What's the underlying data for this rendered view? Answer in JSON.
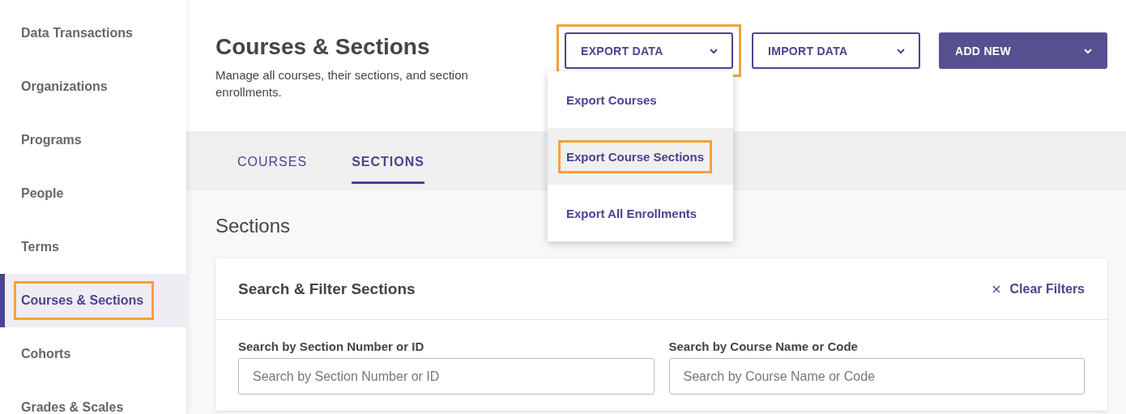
{
  "sidebar": {
    "items": [
      {
        "label": "Data Transactions",
        "selected": false,
        "highlighted": false
      },
      {
        "label": "Organizations",
        "selected": false,
        "highlighted": false
      },
      {
        "label": "Programs",
        "selected": false,
        "highlighted": false
      },
      {
        "label": "People",
        "selected": false,
        "highlighted": false
      },
      {
        "label": "Terms",
        "selected": false,
        "highlighted": false
      },
      {
        "label": "Courses & Sections",
        "selected": true,
        "highlighted": true
      },
      {
        "label": "Cohorts",
        "selected": false,
        "highlighted": false
      },
      {
        "label": "Grades & Scales",
        "selected": false,
        "highlighted": false
      }
    ]
  },
  "header": {
    "title": "Courses & Sections",
    "subtitle": "Manage all courses, their sections, and section enrollments.",
    "buttons": [
      {
        "label": "EXPORT DATA",
        "kind": "outline",
        "highlighted": true,
        "menu": [
          {
            "label": "Export Courses",
            "hovered": false,
            "highlighted": false
          },
          {
            "label": "Export Course Sections",
            "hovered": true,
            "highlighted": true
          },
          {
            "label": "Export All Enrollments",
            "hovered": false,
            "highlighted": false
          }
        ]
      },
      {
        "label": "IMPORT DATA",
        "kind": "outline",
        "highlighted": false
      },
      {
        "label": "ADD NEW",
        "kind": "filled",
        "highlighted": false
      }
    ]
  },
  "tabs": [
    {
      "label": "COURSES",
      "selected": false
    },
    {
      "label": "SECTIONS",
      "selected": true
    }
  ],
  "section_title": "Sections",
  "filter_card": {
    "title": "Search & Filter Sections",
    "clear_label": "Clear Filters",
    "fields": [
      {
        "label": "Search by Section Number or ID",
        "placeholder": "Search by Section Number or ID"
      },
      {
        "label": "Search by Course Name or Code",
        "placeholder": "Search by Course Name or Code"
      }
    ]
  }
}
